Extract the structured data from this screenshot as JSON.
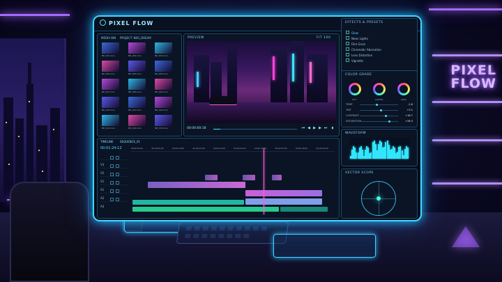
{
  "app": {
    "name": "PIXEL FLOW"
  },
  "wall_sign": {
    "line1": "PIXEL",
    "line2": "FLOW"
  },
  "media_bin": {
    "tabs": [
      "MEDIA BIN",
      "PROJECT: NEO_DREAM"
    ],
    "clips": [
      "NE_001.mov",
      "NE_002.mov",
      "NE_003.mov",
      "NE_004.mov",
      "NE_005.mov",
      "NE_006.mov",
      "NE_007.mov",
      "NE_008.mov",
      "NE_009.mov",
      "NE_010.mov",
      "NE_011.mov",
      "NE_012.mov",
      "NE_013.mov",
      "NE_014.mov",
      "NE_015.mov"
    ]
  },
  "preview": {
    "title": "PREVIEW",
    "zoom": "FIT 100",
    "timecode": "00:00:00:18"
  },
  "effects": {
    "title": "EFFECTS & PRESETS",
    "items": [
      "Glow",
      "Neon Lights",
      "Film Grain",
      "Chromatic Aberration",
      "Lens Distortion",
      "Vignette"
    ]
  },
  "color_grade": {
    "title": "COLOR GRADE",
    "wheels": [
      "LIFT",
      "GAMMA",
      "GAIN"
    ],
    "rows": [
      {
        "label": "TEMP",
        "value": "-2.6",
        "pos": 0.45
      },
      {
        "label": "TINT",
        "value": "+3.1",
        "pos": 0.55
      },
      {
        "label": "CONTRAST",
        "value": "+18.7",
        "pos": 0.7
      },
      {
        "label": "SATURATION",
        "value": "+26.3",
        "pos": 0.78
      }
    ]
  },
  "waveform": {
    "title": "WAVEFORM"
  },
  "vector_scope": {
    "title": "VECTOR SCOPE"
  },
  "timeline": {
    "title": "TIMELINE",
    "sequence": "SEQUENCE_01",
    "timecode": "00:01:24:12",
    "ruler": [
      "00:00:00:00",
      "00:00:05:00",
      "00:00:10:00",
      "00:00:15:00",
      "00:00:20:00",
      "00:00:25:00",
      "00:00:30:00",
      "00:00:35:00",
      "00:00:40:00",
      "00:00:45:00"
    ],
    "tracks": [
      "V3",
      "V2",
      "V1",
      "A1",
      "A2",
      "A3"
    ]
  }
}
